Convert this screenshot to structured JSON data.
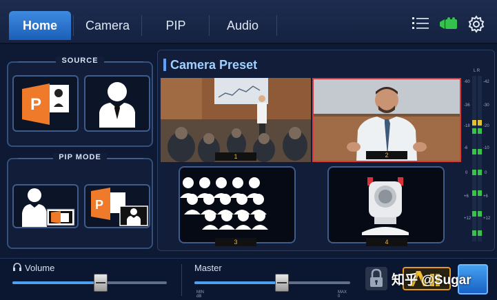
{
  "tabs": [
    {
      "label": "Home",
      "active": true
    },
    {
      "label": "Camera",
      "active": false
    },
    {
      "label": "PIP",
      "active": false
    },
    {
      "label": "Audio",
      "active": false
    }
  ],
  "top_icons": [
    "list-icon",
    "camera-icon",
    "gear-icon"
  ],
  "source": {
    "title": "SOURCE",
    "items": [
      {
        "icon": "powerpoint-icon"
      },
      {
        "icon": "presenter-icon"
      }
    ]
  },
  "pip_mode": {
    "title": "PIP MODE",
    "items": [
      {
        "icon": "presenter-with-slides-icon"
      },
      {
        "icon": "slides-with-presenter-icon"
      }
    ]
  },
  "preset": {
    "title": "Camera Preset",
    "cells": [
      {
        "number": "1",
        "selected": false
      },
      {
        "number": "2",
        "selected": true
      },
      {
        "number": "3",
        "selected": false
      },
      {
        "number": "4",
        "selected": false
      }
    ]
  },
  "meter": {
    "channels": "L R",
    "scale": [
      "-60",
      "-36",
      "-18",
      "-6",
      "0",
      "+6",
      "+12"
    ],
    "right_scale": [
      "-42",
      "-30",
      "-20",
      "-10",
      "0",
      "+6",
      "+12"
    ]
  },
  "volume": {
    "label": "Volume",
    "level": 0.57
  },
  "master": {
    "label": "Master",
    "level": 0.56,
    "min": "MIN dB",
    "max": "MAX 0"
  },
  "watermark": "知乎 @Sugar",
  "colors": {
    "accent": "#2f7de0",
    "selected_border": "#e0353a",
    "meter_green": "#37c24a",
    "meter_yellow": "#e6c229"
  }
}
